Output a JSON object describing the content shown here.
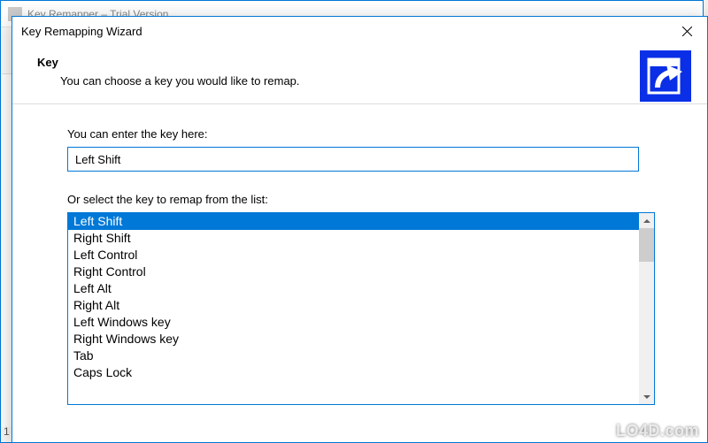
{
  "parent_window": {
    "title_hint": "Key Remapper – Trial Version",
    "row_number": "1"
  },
  "wizard": {
    "title": "Key Remapping Wizard",
    "header_title": "Key",
    "header_subtitle": "You can choose a key you would like to remap.",
    "input_label": "You can enter the key here:",
    "input_value": "Left Shift",
    "list_label": "Or select the key to remap from the list:",
    "keys": [
      "Left Shift",
      "Right Shift",
      "Left Control",
      "Right Control",
      "Left Alt",
      "Right Alt",
      "Left Windows key",
      "Right Windows key",
      "Tab",
      "Caps Lock"
    ],
    "selected_index": 0
  },
  "watermark": "LO4D.com"
}
